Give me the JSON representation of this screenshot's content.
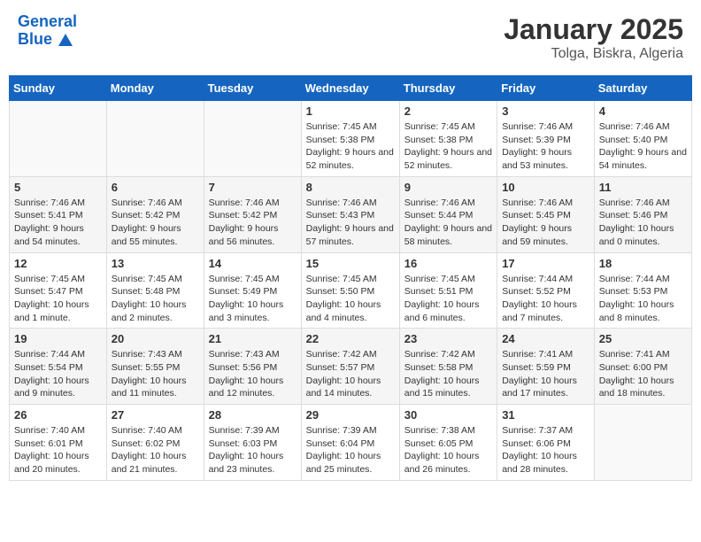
{
  "header": {
    "logo_line1": "General",
    "logo_line2": "Blue",
    "title": "January 2025",
    "subtitle": "Tolga, Biskra, Algeria"
  },
  "days_of_week": [
    "Sunday",
    "Monday",
    "Tuesday",
    "Wednesday",
    "Thursday",
    "Friday",
    "Saturday"
  ],
  "weeks": [
    [
      {
        "day": "",
        "info": ""
      },
      {
        "day": "",
        "info": ""
      },
      {
        "day": "",
        "info": ""
      },
      {
        "day": "1",
        "info": "Sunrise: 7:45 AM\nSunset: 5:38 PM\nDaylight: 9 hours and 52 minutes."
      },
      {
        "day": "2",
        "info": "Sunrise: 7:45 AM\nSunset: 5:38 PM\nDaylight: 9 hours and 52 minutes."
      },
      {
        "day": "3",
        "info": "Sunrise: 7:46 AM\nSunset: 5:39 PM\nDaylight: 9 hours and 53 minutes."
      },
      {
        "day": "4",
        "info": "Sunrise: 7:46 AM\nSunset: 5:40 PM\nDaylight: 9 hours and 54 minutes."
      }
    ],
    [
      {
        "day": "5",
        "info": "Sunrise: 7:46 AM\nSunset: 5:41 PM\nDaylight: 9 hours and 54 minutes."
      },
      {
        "day": "6",
        "info": "Sunrise: 7:46 AM\nSunset: 5:42 PM\nDaylight: 9 hours and 55 minutes."
      },
      {
        "day": "7",
        "info": "Sunrise: 7:46 AM\nSunset: 5:42 PM\nDaylight: 9 hours and 56 minutes."
      },
      {
        "day": "8",
        "info": "Sunrise: 7:46 AM\nSunset: 5:43 PM\nDaylight: 9 hours and 57 minutes."
      },
      {
        "day": "9",
        "info": "Sunrise: 7:46 AM\nSunset: 5:44 PM\nDaylight: 9 hours and 58 minutes."
      },
      {
        "day": "10",
        "info": "Sunrise: 7:46 AM\nSunset: 5:45 PM\nDaylight: 9 hours and 59 minutes."
      },
      {
        "day": "11",
        "info": "Sunrise: 7:46 AM\nSunset: 5:46 PM\nDaylight: 10 hours and 0 minutes."
      }
    ],
    [
      {
        "day": "12",
        "info": "Sunrise: 7:45 AM\nSunset: 5:47 PM\nDaylight: 10 hours and 1 minute."
      },
      {
        "day": "13",
        "info": "Sunrise: 7:45 AM\nSunset: 5:48 PM\nDaylight: 10 hours and 2 minutes."
      },
      {
        "day": "14",
        "info": "Sunrise: 7:45 AM\nSunset: 5:49 PM\nDaylight: 10 hours and 3 minutes."
      },
      {
        "day": "15",
        "info": "Sunrise: 7:45 AM\nSunset: 5:50 PM\nDaylight: 10 hours and 4 minutes."
      },
      {
        "day": "16",
        "info": "Sunrise: 7:45 AM\nSunset: 5:51 PM\nDaylight: 10 hours and 6 minutes."
      },
      {
        "day": "17",
        "info": "Sunrise: 7:44 AM\nSunset: 5:52 PM\nDaylight: 10 hours and 7 minutes."
      },
      {
        "day": "18",
        "info": "Sunrise: 7:44 AM\nSunset: 5:53 PM\nDaylight: 10 hours and 8 minutes."
      }
    ],
    [
      {
        "day": "19",
        "info": "Sunrise: 7:44 AM\nSunset: 5:54 PM\nDaylight: 10 hours and 9 minutes."
      },
      {
        "day": "20",
        "info": "Sunrise: 7:43 AM\nSunset: 5:55 PM\nDaylight: 10 hours and 11 minutes."
      },
      {
        "day": "21",
        "info": "Sunrise: 7:43 AM\nSunset: 5:56 PM\nDaylight: 10 hours and 12 minutes."
      },
      {
        "day": "22",
        "info": "Sunrise: 7:42 AM\nSunset: 5:57 PM\nDaylight: 10 hours and 14 minutes."
      },
      {
        "day": "23",
        "info": "Sunrise: 7:42 AM\nSunset: 5:58 PM\nDaylight: 10 hours and 15 minutes."
      },
      {
        "day": "24",
        "info": "Sunrise: 7:41 AM\nSunset: 5:59 PM\nDaylight: 10 hours and 17 minutes."
      },
      {
        "day": "25",
        "info": "Sunrise: 7:41 AM\nSunset: 6:00 PM\nDaylight: 10 hours and 18 minutes."
      }
    ],
    [
      {
        "day": "26",
        "info": "Sunrise: 7:40 AM\nSunset: 6:01 PM\nDaylight: 10 hours and 20 minutes."
      },
      {
        "day": "27",
        "info": "Sunrise: 7:40 AM\nSunset: 6:02 PM\nDaylight: 10 hours and 21 minutes."
      },
      {
        "day": "28",
        "info": "Sunrise: 7:39 AM\nSunset: 6:03 PM\nDaylight: 10 hours and 23 minutes."
      },
      {
        "day": "29",
        "info": "Sunrise: 7:39 AM\nSunset: 6:04 PM\nDaylight: 10 hours and 25 minutes."
      },
      {
        "day": "30",
        "info": "Sunrise: 7:38 AM\nSunset: 6:05 PM\nDaylight: 10 hours and 26 minutes."
      },
      {
        "day": "31",
        "info": "Sunrise: 7:37 AM\nSunset: 6:06 PM\nDaylight: 10 hours and 28 minutes."
      },
      {
        "day": "",
        "info": ""
      }
    ]
  ]
}
